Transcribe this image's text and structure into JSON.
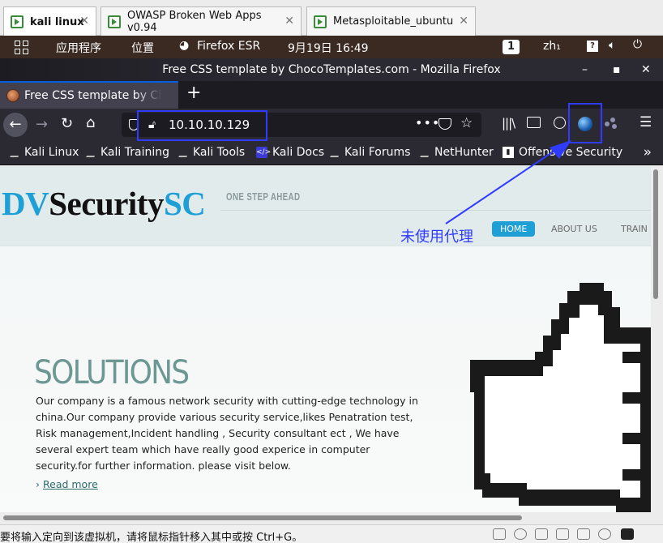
{
  "vm_tabs": [
    {
      "label": "kali linux",
      "active": true
    },
    {
      "label": "OWASP Broken Web Apps v0.94",
      "active": false
    },
    {
      "label": "Metasploitable_ubuntu",
      "active": false
    }
  ],
  "topbar": {
    "apps_label": "应用程序",
    "places_label": "位置",
    "firefox_label": "Firefox ESR",
    "datetime": "9月19日  16:49",
    "workspace": "1",
    "lang": "zh₁"
  },
  "window": {
    "title": "Free CSS template by ChocoTemplates.com - Mozilla Firefox",
    "minimize": "–",
    "maximize": "▪",
    "close": "✕"
  },
  "browser_tab": {
    "label": "Free CSS template by ChocoTemplates.com",
    "new_tab": "+"
  },
  "navbar": {
    "url": "10.10.10.129",
    "dots": "•••"
  },
  "bookmarks": [
    {
      "label": "Kali Linux",
      "icon": "kali"
    },
    {
      "label": "Kali Training",
      "icon": "kali"
    },
    {
      "label": "Kali Tools",
      "icon": "kali"
    },
    {
      "label": "Kali Docs",
      "icon": "doc"
    },
    {
      "label": "Kali Forums",
      "icon": "kali"
    },
    {
      "label": "NetHunter",
      "icon": "kali"
    },
    {
      "label": "Offensive Security",
      "icon": "os"
    }
  ],
  "site": {
    "logo_dv": "DV",
    "logo_security": "Security",
    "logo_sc": "SC",
    "tagline": "ONE STEP AHEAD",
    "menu": [
      "HOME",
      "ABOUT US",
      "TRAIN"
    ],
    "solutions_title": "SOLUTIONS",
    "solutions_text": "Our company is a famous network security with cutting-edge technology in china.Our company provide various security service,likes Penatration test, Risk management,Incident handling , Security consultant ect , We have several expert team which have really good experice in computer security.for further information. please visit below.",
    "read_more": "Read more"
  },
  "annotation": {
    "label": "未使用代理",
    "color": "#2f3cff"
  },
  "statusbar": {
    "message": "要将输入定向到该虚拟机，请将鼠标指针移入其中或按 Ctrl+G。"
  },
  "colors": {
    "accent": "#1e9fd6",
    "topbar_bg": "#3b2a22",
    "firefox_toolbar": "#2b2a33"
  }
}
